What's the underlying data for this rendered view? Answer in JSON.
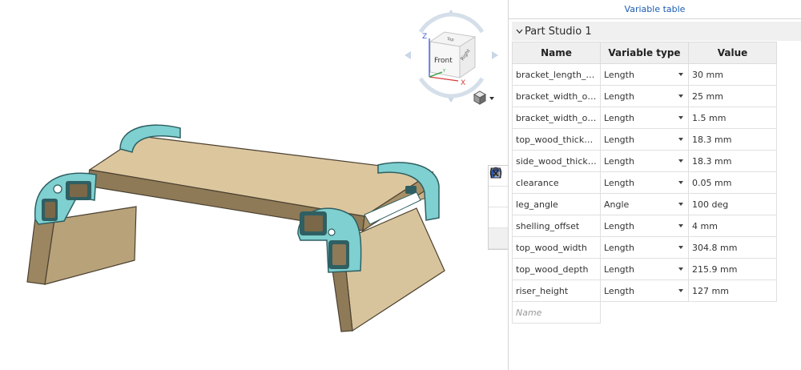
{
  "viewcube": {
    "front": "Front",
    "top": "Top",
    "right": "Right",
    "axis_x": "X",
    "axis_y": "Y",
    "axis_z": "Z"
  },
  "panel": {
    "title": "Variable table",
    "studio": "Part Studio 1",
    "columns": {
      "name": "Name",
      "type": "Variable type",
      "value": "Value"
    },
    "rows": [
      {
        "name": "bracket_length_ove…",
        "type": "Length",
        "value": "30 mm"
      },
      {
        "name": "bracket_width_over…",
        "type": "Length",
        "value": "25 mm"
      },
      {
        "name": "bracket_width_offset",
        "type": "Length",
        "value": "1.5 mm"
      },
      {
        "name": "top_wood_thickness",
        "type": "Length",
        "value": "18.3 mm"
      },
      {
        "name": "side_wood_thickness",
        "type": "Length",
        "value": "18.3 mm"
      },
      {
        "name": "clearance",
        "type": "Length",
        "value": "0.05 mm"
      },
      {
        "name": "leg_angle",
        "type": "Angle",
        "value": "100 deg"
      },
      {
        "name": "shelling_offset",
        "type": "Length",
        "value": "4 mm"
      },
      {
        "name": "top_wood_width",
        "type": "Length",
        "value": "304.8 mm"
      },
      {
        "name": "top_wood_depth",
        "type": "Length",
        "value": "215.9 mm"
      },
      {
        "name": "riser_height",
        "type": "Length",
        "value": "127 mm"
      }
    ],
    "new_name_placeholder": "Name"
  },
  "colors": {
    "wood": "#d9c39a",
    "wood_side": "#a89066",
    "bracket": "#7fd0d0",
    "bracket_dark": "#2f5f62",
    "link": "#1a5bb5"
  }
}
